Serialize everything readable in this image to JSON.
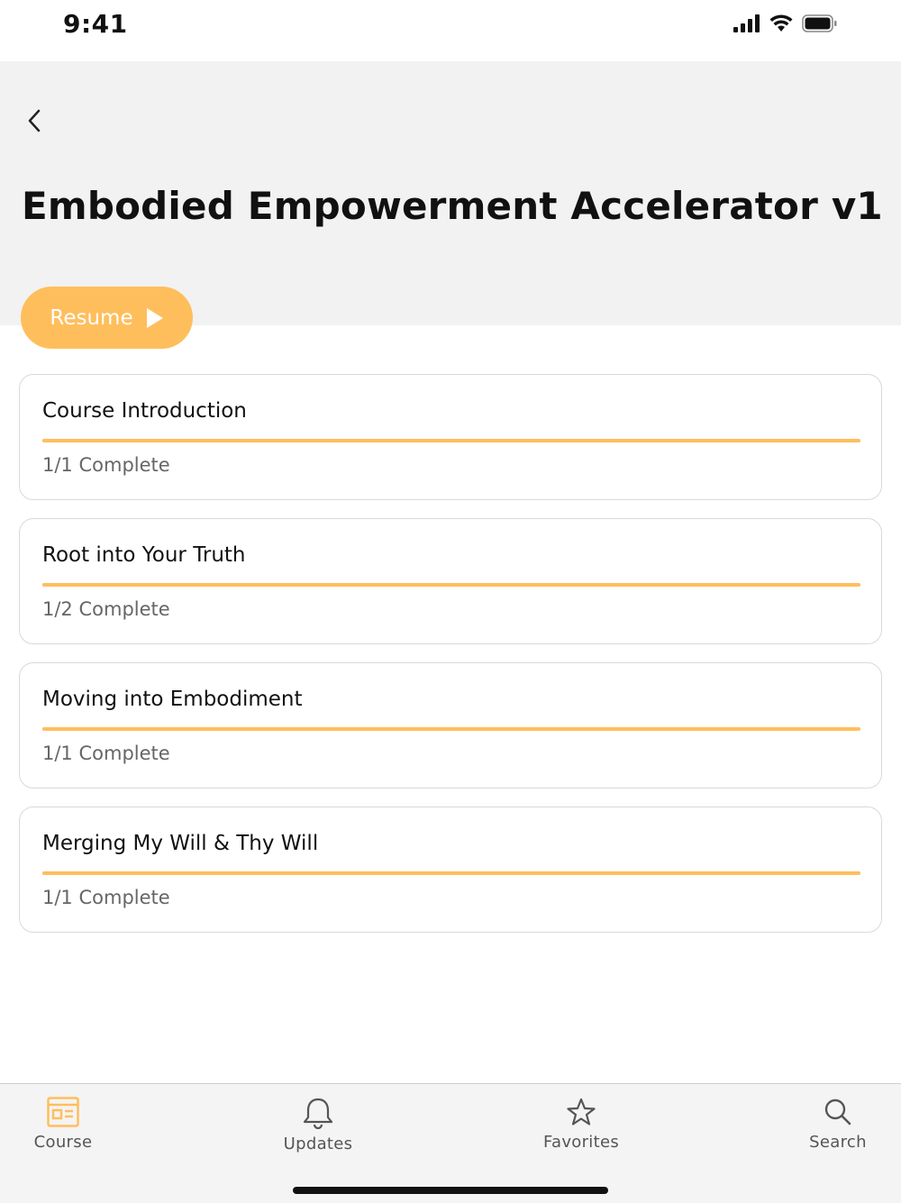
{
  "status_bar": {
    "time": "9:41"
  },
  "header": {
    "title": "Embodied Empowerment Accelerator v1"
  },
  "resume": {
    "label": "Resume"
  },
  "sections": [
    {
      "title": "Course Introduction",
      "status": "1/1 Complete",
      "progress": 1.0
    },
    {
      "title": "Root into Your Truth",
      "status": "1/2 Complete",
      "progress": 1.0
    },
    {
      "title": "Moving into Embodiment",
      "status": "1/1 Complete",
      "progress": 1.0
    },
    {
      "title": "Merging My Will & Thy Will",
      "status": "1/1 Complete",
      "progress": 1.0
    }
  ],
  "tabs": [
    {
      "label": "Course",
      "icon": "course-icon",
      "active": true
    },
    {
      "label": "Updates",
      "icon": "bell-icon",
      "active": false
    },
    {
      "label": "Favorites",
      "icon": "star-icon",
      "active": false
    },
    {
      "label": "Search",
      "icon": "search-icon",
      "active": false
    }
  ],
  "colors": {
    "accent": "#FFBE5C",
    "header_bg": "#f2f2f2"
  }
}
